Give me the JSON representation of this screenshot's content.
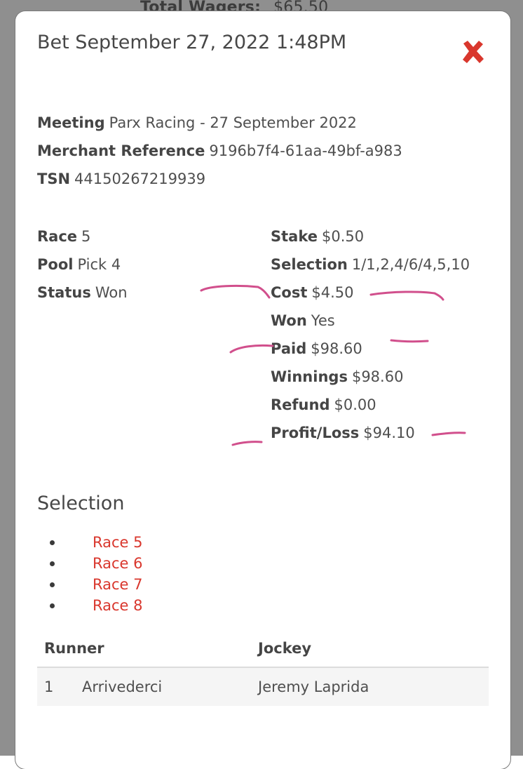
{
  "background": {
    "label": "Total Wagers:",
    "value": "$65.50"
  },
  "modal": {
    "title": "Bet September 27, 2022 1:48PM",
    "close_icon": "close-x-icon",
    "close_color": "#d9372d"
  },
  "details": {
    "meeting_label": "Meeting",
    "meeting_value": "Parx Racing - 27 September 2022",
    "merchant_label": "Merchant Reference",
    "merchant_value": "9196b7f4-61aa-49bf-a983",
    "tsn_label": "TSN",
    "tsn_value": "44150267219939"
  },
  "left_col": {
    "race_label": "Race",
    "race_value": "5",
    "pool_label": "Pool",
    "pool_value": "Pick 4",
    "status_label": "Status",
    "status_value": "Won"
  },
  "right_col": {
    "stake_label": "Stake",
    "stake_value": "$0.50",
    "selection_label": "Selection",
    "selection_value": "1/1,2,4/6/4,5,10",
    "cost_label": "Cost",
    "cost_value": "$4.50",
    "won_label": "Won",
    "won_value": "Yes",
    "paid_label": "Paid",
    "paid_value": "$98.60",
    "winnings_label": "Winnings",
    "winnings_value": "$98.60",
    "refund_label": "Refund",
    "refund_value": "$0.00",
    "profit_label": "Profit/Loss",
    "profit_value": "$94.10"
  },
  "selection": {
    "heading": "Selection",
    "races": [
      "Race 5",
      "Race 6",
      "Race 7",
      "Race 8"
    ],
    "link_color": "#d9372d"
  },
  "table": {
    "headers": [
      "Runner",
      "Jockey"
    ],
    "rows": [
      {
        "number": "1",
        "runner": "Arrivederci",
        "jockey": "Jeremy Laprida"
      }
    ]
  },
  "annotation_color": "#d14f8c"
}
